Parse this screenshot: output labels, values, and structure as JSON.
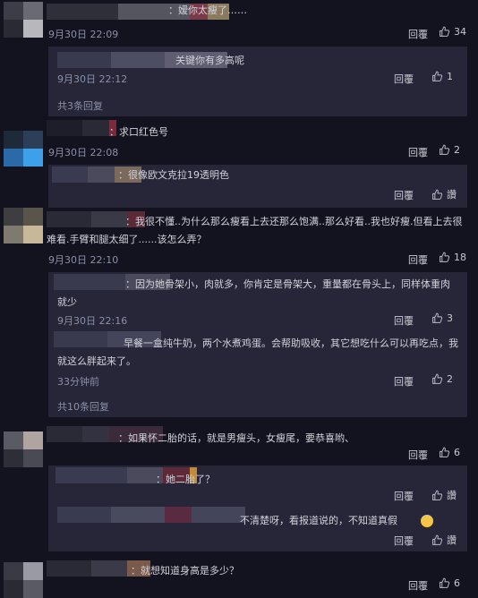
{
  "comments": [
    {
      "text": "：嫒你太瘦了……",
      "time": "9月30日 22:09",
      "reply": "回覆",
      "likes": "34",
      "avatar": [
        "#3d3d48",
        "#6a6a74",
        "#2a2a34",
        "#b8b8bc"
      ],
      "name": [
        "#2f2f3a",
        "#55555f",
        "#7a3a4a",
        "#8a7a5e"
      ],
      "subs": [
        {
          "text": "关键你有多高呢",
          "time": "9月30日 22:12",
          "reply": "回覆",
          "likes": "1",
          "name": [
            "#3a3a4e",
            "#4e4e62",
            "#5e5e70"
          ]
        }
      ],
      "more": "共3条回复"
    },
    {
      "text": "：求口红色号",
      "time": "9月30日 22:08",
      "reply": "回覆",
      "likes": "2",
      "avatar": [
        "#1e2a3a",
        "#2b3f58",
        "#2a6aa8",
        "#3ea0e8"
      ],
      "name": [
        "#1e1e2a",
        "#2a2a36",
        "#7a2a3a"
      ],
      "subs": [
        {
          "text": "：很像欧文克拉19透明色",
          "time": "",
          "reply": "回覆",
          "likes": "讚",
          "name": [
            "#3a3a50",
            "#4a4a5c",
            "#7a6a5e"
          ]
        }
      ]
    },
    {
      "text": "：我很不懂..为什么那么瘦看上去还那么饱满..那么好看..我也好瘦.但看上去很难看.手臂和腿太细了......该怎么弄？",
      "time": "9月30日 22:10",
      "reply": "回覆",
      "likes": "18",
      "avatar": [
        "#3e3e40",
        "#5a554a",
        "#7e7a70",
        "#c8b89a"
      ],
      "name": [
        "#2a2a36",
        "#3a3a46",
        "#5a2a36"
      ],
      "subs": [
        {
          "text": "：因为她骨架小，肉就多，你肯定是骨架大，重量都在骨头上，同样体重肉就少",
          "time": "9月30日 22:16",
          "reply": "回覆",
          "likes": "3",
          "name": [
            "#3a3a4e",
            "#4a4a5c"
          ]
        },
        {
          "text": "早餐一盒纯牛奶，两个水煮鸡蛋。会帮助吸收，其它想吃什么可以再吃点，我就这么胖起来了。",
          "time": "33分钟前",
          "reply": "回覆",
          "likes": "2",
          "name": [
            "#3a3a4e",
            "#44445a"
          ]
        }
      ],
      "more": "共10条回复"
    },
    {
      "text": "：如果怀二胎的话，就是男瘦头，女瘦尾，要恭喜哟、",
      "time": "",
      "reply": "回覆",
      "likes": "6",
      "avatar": [
        "#5a5a64",
        "#b0a4a0",
        "#2e2e38",
        "#4a4a54"
      ],
      "name": [
        "#2a2a36",
        "#323240",
        "#3a2a3a"
      ],
      "subs": [
        {
          "text": "：她二胎了？",
          "time": "",
          "reply": "回覆",
          "likes": "讚",
          "name": [
            "#3a3a50",
            "#4a4a5c",
            "#5e2a3a",
            "#c08a3a"
          ]
        },
        {
          "text": "不清楚呀，看报道说的，不知道真假",
          "time": "",
          "reply": "回覆",
          "likes": "讚",
          "name": [
            "#3a3a50",
            "#4a4a5e",
            "#5a2a40",
            "#44445a"
          ]
        }
      ]
    },
    {
      "text": "：就想知道身高是多少？",
      "time": "",
      "reply": "回覆",
      "likes": "6",
      "avatar": [
        "#3a3a44",
        "#9a9aa4",
        "#2a2a34",
        "#5a5a64"
      ],
      "name": [
        "#2a2a36",
        "#3a3a48",
        "#7a5a4a"
      ]
    }
  ]
}
